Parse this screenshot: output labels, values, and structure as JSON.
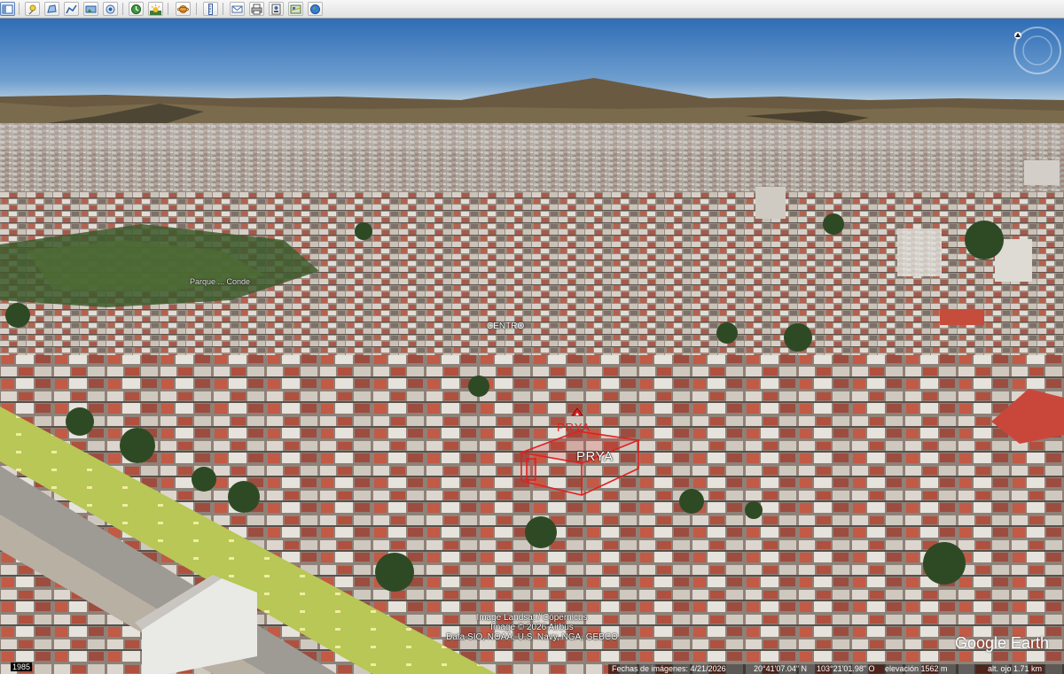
{
  "app": {
    "name": "Google Earth",
    "logo_text": "Google Earth"
  },
  "toolbar": {
    "buttons": [
      {
        "name": "sidebar-toggle-button",
        "icon": "sidebar-icon"
      },
      {
        "name": "add-placemark-button",
        "icon": "pushpin-icon"
      },
      {
        "name": "add-polygon-button",
        "icon": "polygon-icon"
      },
      {
        "name": "add-path-button",
        "icon": "path-icon"
      },
      {
        "name": "add-overlay-button",
        "icon": "image-overlay-icon"
      },
      {
        "name": "record-tour-button",
        "icon": "record-tour-icon"
      },
      {
        "name": "historical-imagery-button",
        "icon": "clock-icon"
      },
      {
        "name": "sunlight-button",
        "icon": "sun-icon"
      },
      {
        "name": "switch-planet-button",
        "icon": "planet-icon"
      },
      {
        "name": "ruler-button",
        "icon": "ruler-icon"
      },
      {
        "name": "email-button",
        "icon": "envelope-icon"
      },
      {
        "name": "print-button",
        "icon": "printer-icon"
      },
      {
        "name": "save-image-button",
        "icon": "save-image-icon"
      },
      {
        "name": "view-in-maps-button",
        "icon": "map-icon"
      },
      {
        "name": "earth-button",
        "icon": "globe-icon"
      }
    ]
  },
  "map": {
    "labels": {
      "parque": "Parque ... Conde",
      "centro": "CENTRO",
      "placemark": "PRYA",
      "building_sign": "PRYA"
    },
    "attribution": [
      "Image Landsat / Copernicus",
      "Image © 2026 Airbus",
      "Data SIO, NOAA, U.S. Navy, NGA, GEBCO"
    ],
    "year_badge": "1985"
  },
  "status": {
    "imagery_date": "Fechas de imágenes: 4/21/2026",
    "latitude": "20°41'07.04\" N",
    "longitude": "103°21'01.98\" O",
    "elevation": "elevación  1562 m",
    "eye_altitude": "alt. ojo   1.71 km"
  },
  "colors": {
    "sky_top": "#2f6db6",
    "sky_horizon": "#c6d9e6",
    "placemark_red": "#e02020",
    "avenue_green": "#b8c755"
  }
}
